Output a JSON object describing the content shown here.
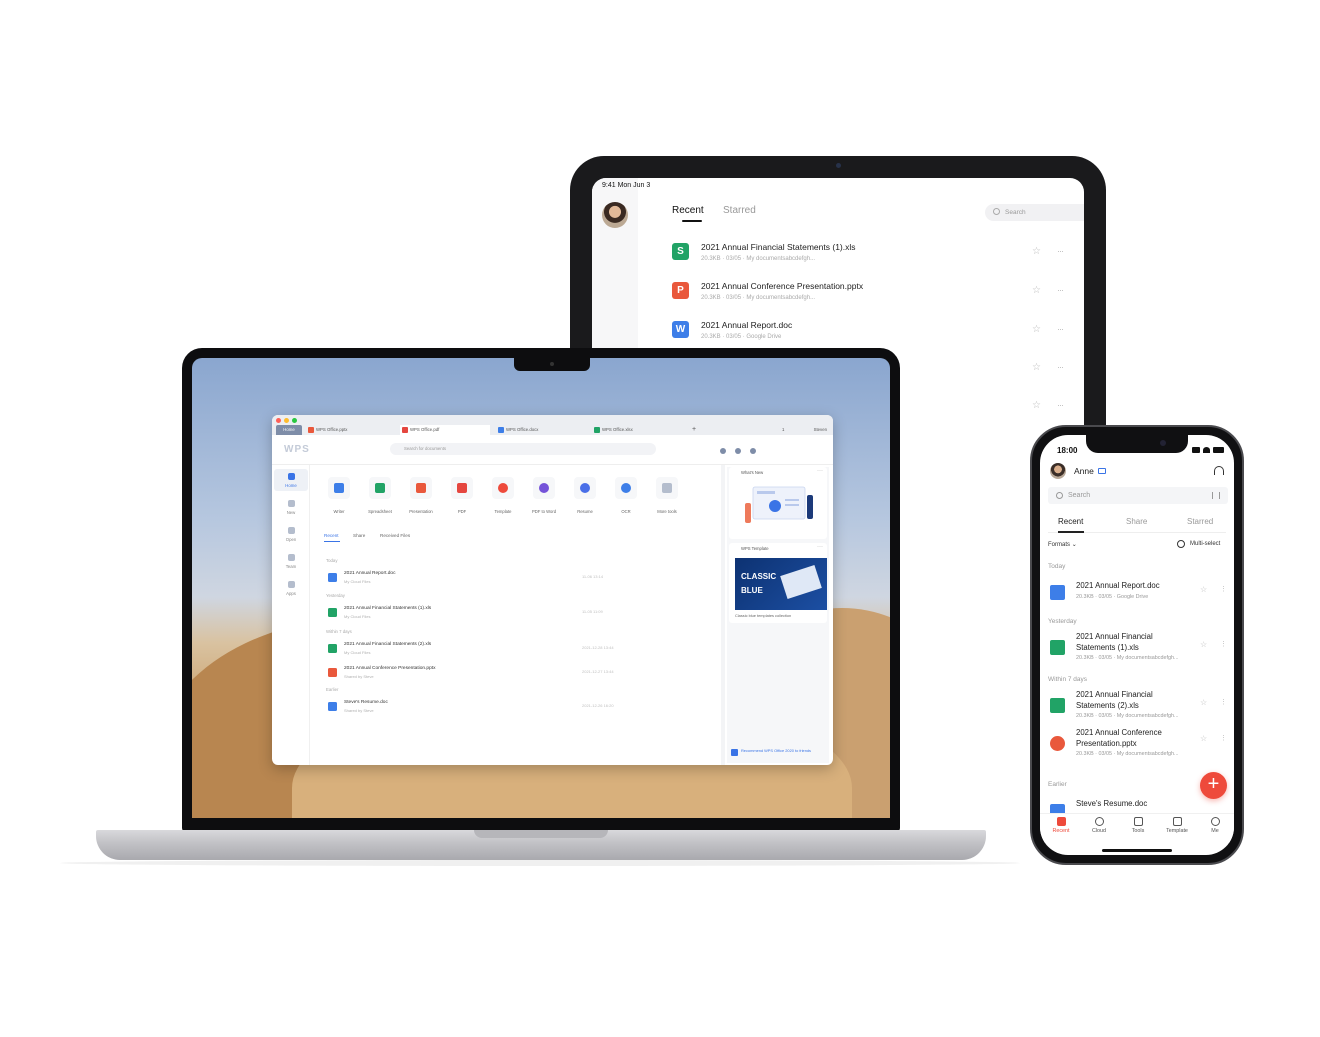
{
  "tablet": {
    "status_time": "9:41  Mon Jun 3",
    "tabs": [
      "Recent",
      "Starred"
    ],
    "search_placeholder": "Search",
    "files": [
      {
        "icon": "S",
        "color": "#21a366",
        "name": "2021 Annual Financial Statements (1).xls",
        "meta": "20.3KB · 03/05 · My documentsabcdefgh..."
      },
      {
        "icon": "P",
        "color": "#e9583c",
        "name": "2021 Annual Conference Presentation.pptx",
        "meta": "20.3KB · 03/05 · My documentsabcdefgh..."
      },
      {
        "icon": "W",
        "color": "#3d7ee8",
        "name": "2021 Annual Report.doc",
        "meta": "20.3KB · 03/05 · Google Drive"
      }
    ]
  },
  "desktop": {
    "tabs": {
      "home": "Home",
      "items": [
        {
          "label": "WPS Office.pptx",
          "color": "#e9583c"
        },
        {
          "label": "WPS Office.pdf",
          "color": "#e5463f"
        },
        {
          "label": "WPS Office.docx",
          "color": "#3d7ee8"
        },
        {
          "label": "WPS Office.xlsx",
          "color": "#21a366"
        }
      ],
      "new_tab": "+",
      "badge": "1",
      "user": "Steven"
    },
    "logo": "WPS",
    "search_placeholder": "Search for documents",
    "sidebar": [
      "Home",
      "New",
      "Open",
      "Team",
      "Apps"
    ],
    "tools": [
      {
        "label": "Writer",
        "color": "#3d7ee8",
        "shape": "square"
      },
      {
        "label": "Spreadsheet",
        "color": "#21a366",
        "shape": "square"
      },
      {
        "label": "Presentation",
        "color": "#e9583c",
        "shape": "square"
      },
      {
        "label": "PDF",
        "color": "#e5463f",
        "shape": "square"
      },
      {
        "label": "Template",
        "color": "#ee4a3b",
        "shape": "round"
      },
      {
        "label": "PDF to Word",
        "color": "#7553d9",
        "shape": "round"
      },
      {
        "label": "Resume",
        "color": "#4a6fe8",
        "shape": "round"
      },
      {
        "label": "OCR",
        "color": "#3d7ee8",
        "shape": "round"
      },
      {
        "label": "More tools",
        "color": "#b4bdcd",
        "shape": "square"
      }
    ],
    "subtabs": [
      "Recent",
      "Share",
      "Received Files"
    ],
    "groups": {
      "today": "Today",
      "yesterday": "Yesterday",
      "within7": "Within 7 days",
      "earlier": "Earlier"
    },
    "files": [
      {
        "name": "2021 Annual Report.doc",
        "source": "My Cloud Files",
        "date": "11-06 13:14",
        "color": "#3d7ee8"
      },
      {
        "name": "2021 Annual Financial Statements (1).xls",
        "source": "My Cloud Files",
        "date": "11-05 11:09",
        "color": "#21a366"
      },
      {
        "name": "2021 Annual Financial Statements (2).xls",
        "source": "My Cloud Files",
        "date": "2021-12-28 13:44",
        "color": "#21a366"
      },
      {
        "name": "2021 Annual Conference Presentation.pptx",
        "source": "Shared by Steve",
        "date": "2021-12-27 13:44",
        "color": "#e9583c"
      },
      {
        "name": "Steve's Resume.doc",
        "source": "Shared by Steve",
        "date": "2021-12-26 16:20",
        "color": "#3d7ee8"
      }
    ],
    "right_panel": {
      "whats_new": "What's New",
      "template_title": "WPS Template",
      "classic_line1": "CLASSIC",
      "classic_line2": "BLUE",
      "template_caption": "Classic blue templates collection",
      "recommend": "Recommend WPS Office 2020 to friends"
    }
  },
  "phone": {
    "time": "18:00",
    "user": "Anne",
    "search_placeholder": "Search",
    "tabs": [
      "Recent",
      "Share",
      "Starred"
    ],
    "formats": "Formats",
    "multi_select": "Multi-select",
    "groups": {
      "today": "Today",
      "yesterday": "Yesterday",
      "within7": "Within 7 days",
      "earlier": "Earlier"
    },
    "files": [
      {
        "name": "2021 Annual Report.doc",
        "meta": "20.3KB · 03/05 · Google Drive",
        "color": "#3d7ee8"
      },
      {
        "name": "2021 Annual Financial Statements (1).xls",
        "meta": "20.3KB · 03/05 · My documentsabcdefgh...",
        "color": "#21a366"
      },
      {
        "name": "2021 Annual Financial Statements (2).xls",
        "meta": "20.3KB · 03/05 · My documentsabcdefgh...",
        "color": "#21a366"
      },
      {
        "name": "2021 Annual Conference Presentation.pptx",
        "meta": "20.3KB · 03/05 · My documentsabcdefgh...",
        "color": "#e9583c"
      },
      {
        "name": "Steve's Resume.doc",
        "meta": "",
        "color": "#3d7ee8"
      }
    ],
    "fab": "+",
    "nav": [
      "Recent",
      "Cloud",
      "Tools",
      "Template",
      "Me"
    ]
  },
  "colors": {
    "accent_blue": "#3a74e6",
    "accent_red": "#ee4a3b"
  }
}
